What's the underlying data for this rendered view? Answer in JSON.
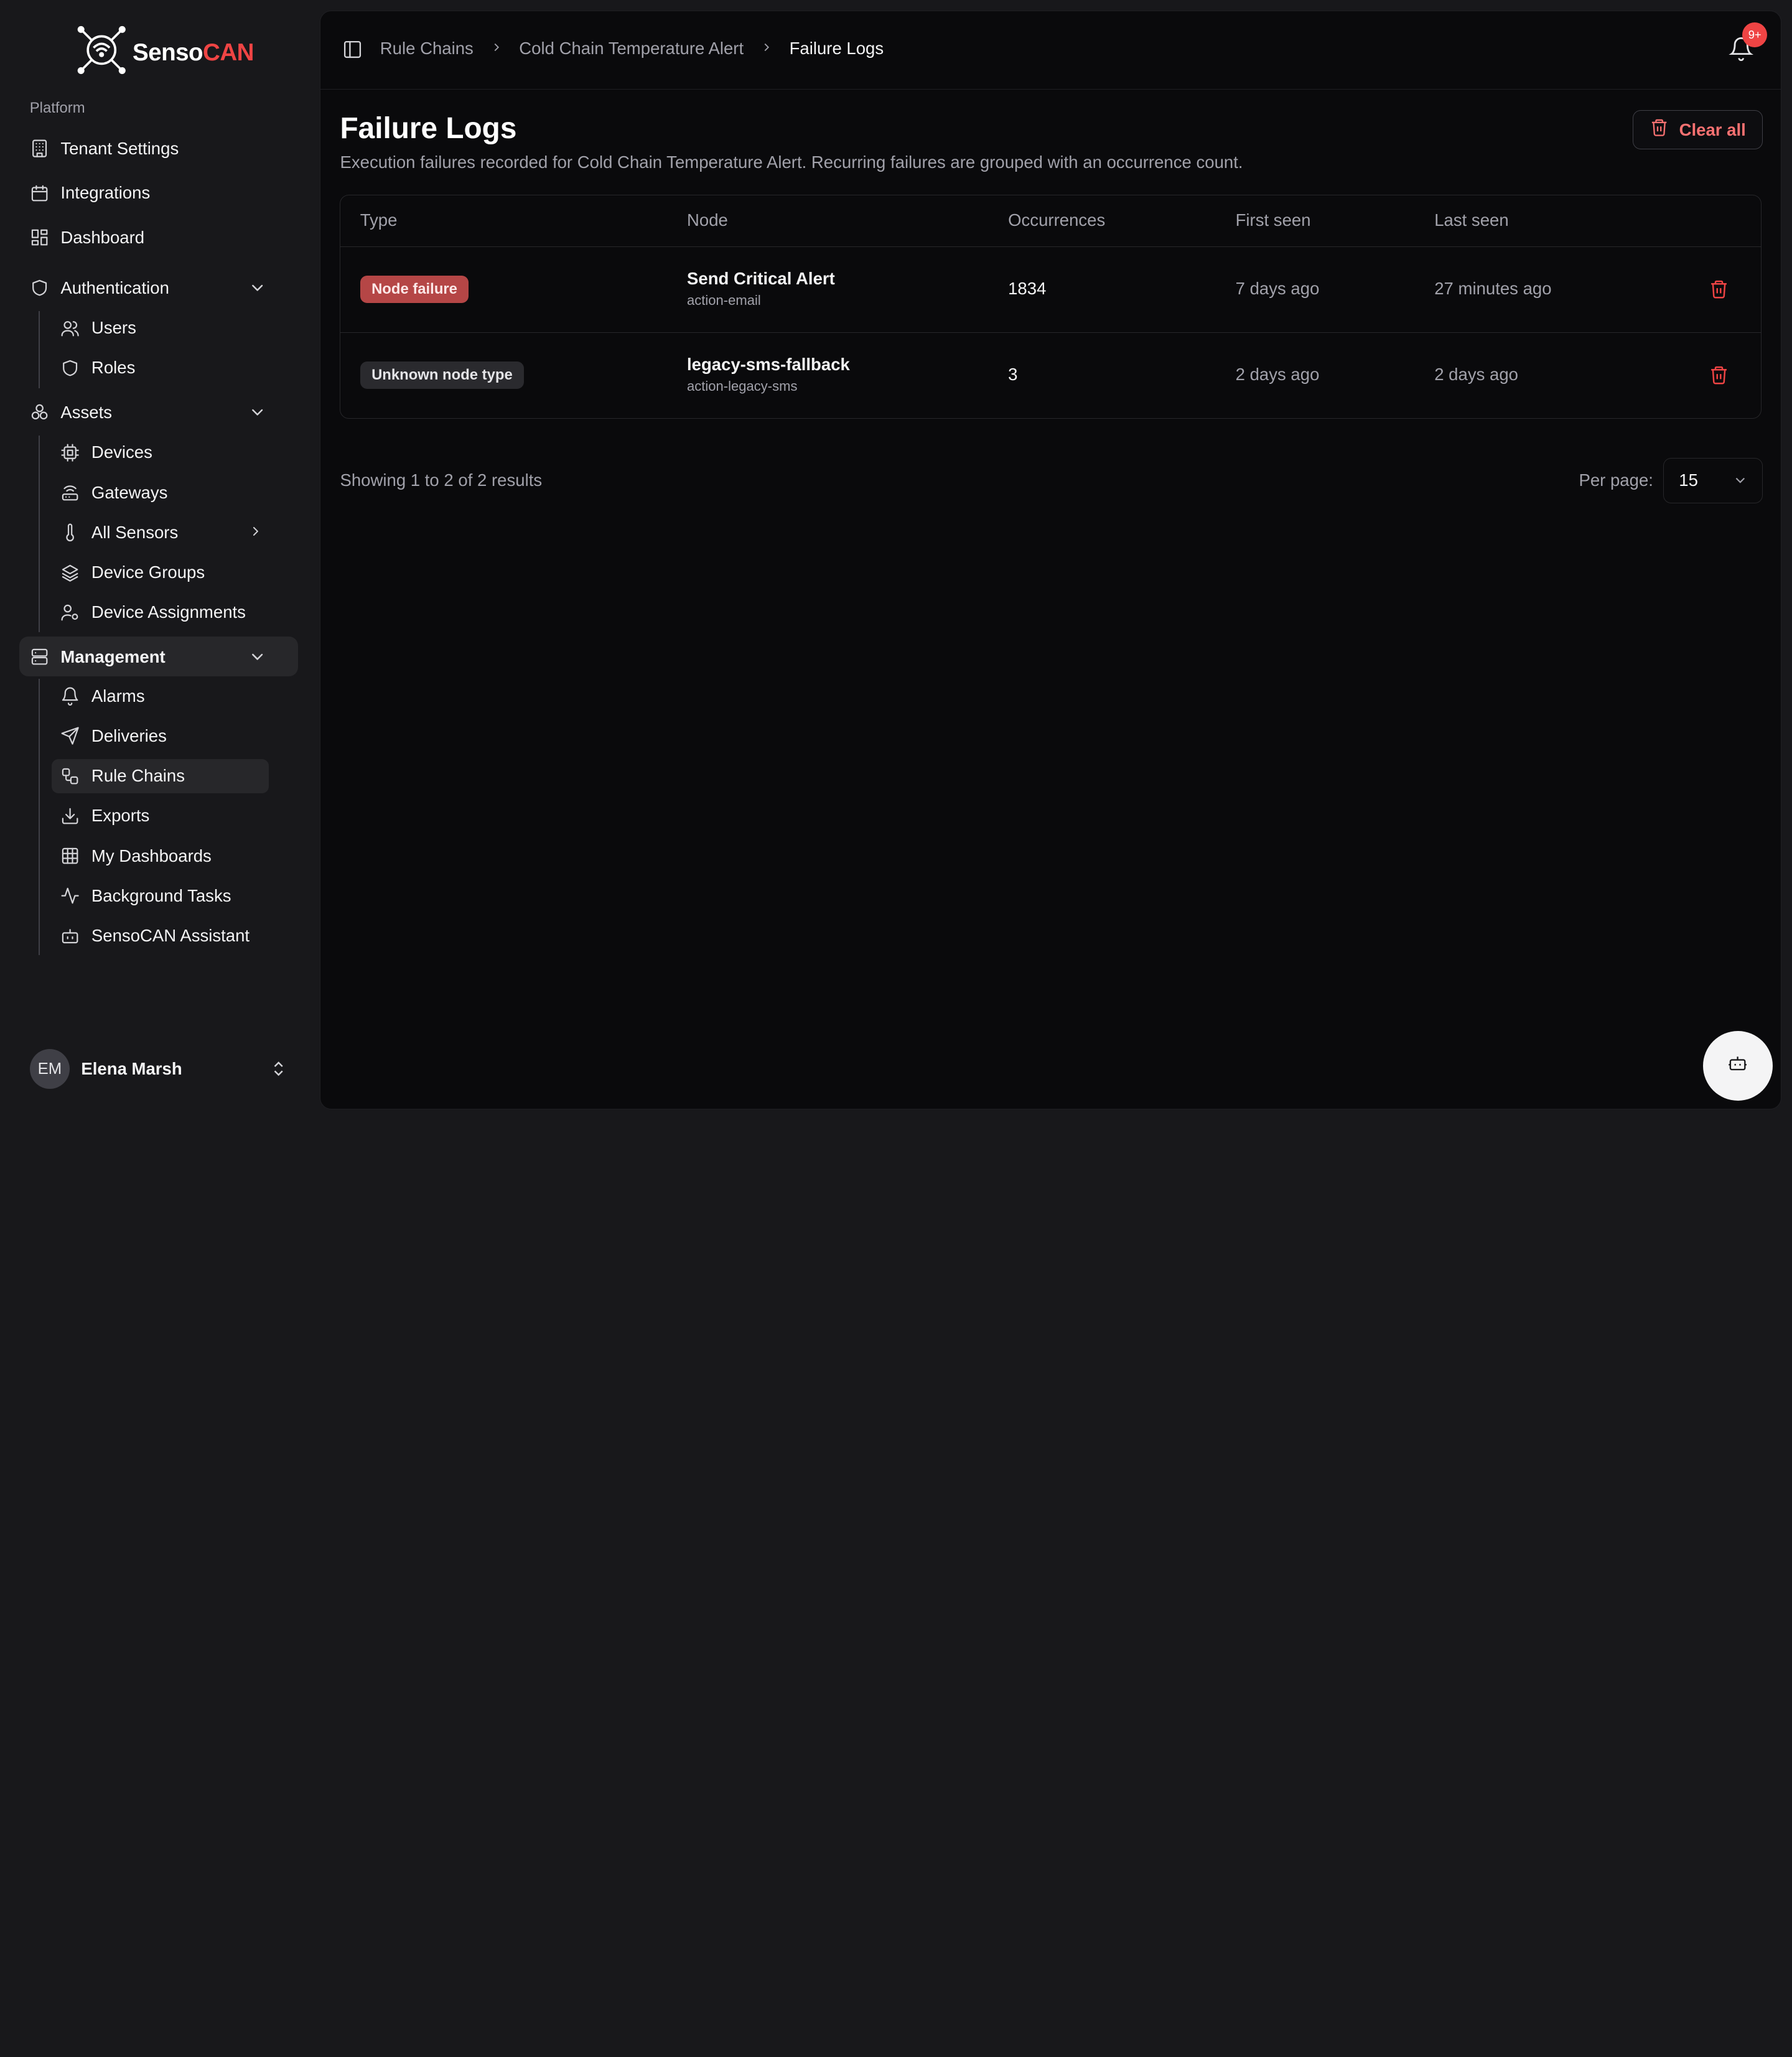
{
  "brand": {
    "name_part1": "Senso",
    "name_part2": "CAN",
    "accent": "#ef4444"
  },
  "sidebar": {
    "section_label": "Platform",
    "items": [
      {
        "label": "Tenant Settings",
        "icon": "building-icon"
      },
      {
        "label": "Integrations",
        "icon": "calendar-icon"
      },
      {
        "label": "Dashboard",
        "icon": "dashboard-icon"
      }
    ],
    "groups": [
      {
        "label": "Authentication",
        "icon": "shield-icon",
        "expanded": true,
        "children": [
          {
            "label": "Users",
            "icon": "users-icon"
          },
          {
            "label": "Roles",
            "icon": "shield-icon"
          }
        ]
      },
      {
        "label": "Assets",
        "icon": "boxes-icon",
        "expanded": true,
        "children": [
          {
            "label": "Devices",
            "icon": "cpu-icon"
          },
          {
            "label": "Gateways",
            "icon": "router-icon"
          },
          {
            "label": "All Sensors",
            "icon": "thermometer-icon"
          },
          {
            "label": "Device Groups",
            "icon": "layers-icon"
          },
          {
            "label": "Device Assignments",
            "icon": "user-cog-icon"
          }
        ]
      },
      {
        "label": "Management",
        "icon": "server-icon",
        "expanded": true,
        "active": true,
        "children": [
          {
            "label": "Alarms",
            "icon": "bell-icon"
          },
          {
            "label": "Deliveries",
            "icon": "send-icon"
          },
          {
            "label": "Rule Chains",
            "icon": "workflow-icon",
            "active": true
          },
          {
            "label": "Exports",
            "icon": "download-icon"
          },
          {
            "label": "My Dashboards",
            "icon": "grid-icon"
          },
          {
            "label": "Background Tasks",
            "icon": "activity-icon"
          },
          {
            "label": "SensoCAN Assistant",
            "icon": "bot-icon"
          }
        ]
      }
    ],
    "user": {
      "initials": "EM",
      "name": "Elena Marsh"
    }
  },
  "topbar": {
    "breadcrumbs": [
      "Rule Chains",
      "Cold Chain Temperature Alert",
      "Failure Logs"
    ],
    "notification_badge": "9+"
  },
  "page": {
    "title": "Failure Logs",
    "subtitle": "Execution failures recorded for Cold Chain Temperature Alert. Recurring failures are grouped with an occurrence count.",
    "clear_all_label": "Clear all"
  },
  "table": {
    "columns": [
      "Type",
      "Node",
      "Occurrences",
      "First seen",
      "Last seen"
    ],
    "rows": [
      {
        "type": "Node failure",
        "type_color": "#b54646",
        "node_name": "Send Critical Alert",
        "node_id": "action-email",
        "occurrences": "1834",
        "first_seen": "7 days ago",
        "last_seen": "27 minutes ago"
      },
      {
        "type": "Unknown node type",
        "type_color": "#2a2a2e",
        "node_name": "legacy-sms-fallback",
        "node_id": "action-legacy-sms",
        "occurrences": "3",
        "first_seen": "2 days ago",
        "last_seen": "2 days ago"
      }
    ]
  },
  "pagination": {
    "summary": "Showing 1 to 2 of 2 results",
    "per_page_label": "Per page:",
    "per_page_value": "15"
  }
}
